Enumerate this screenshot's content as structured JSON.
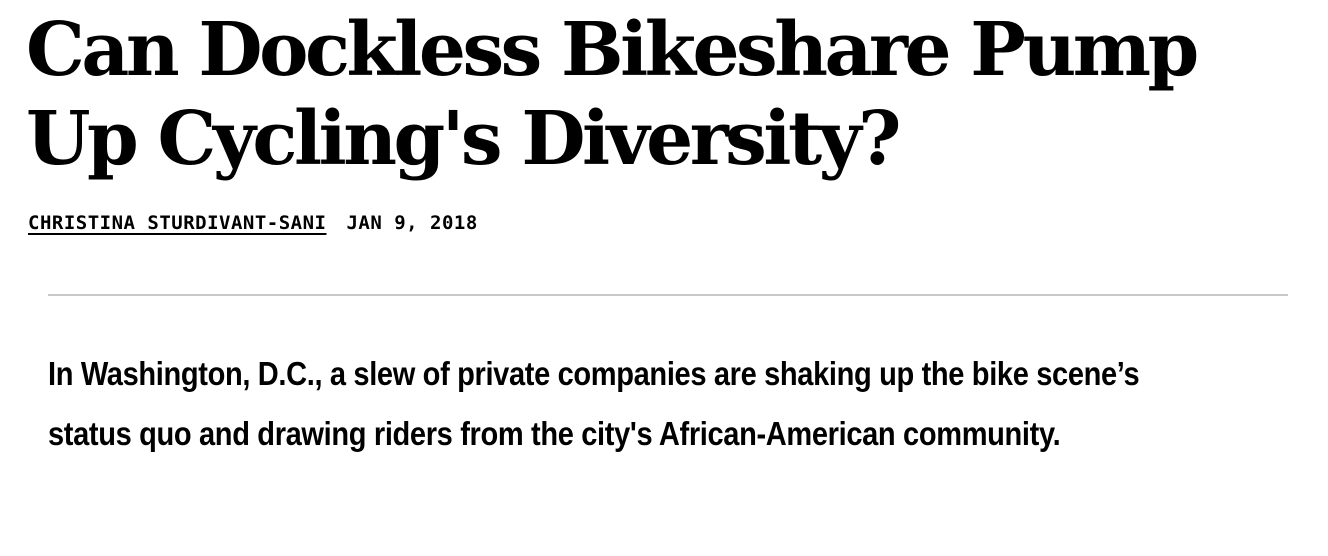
{
  "article": {
    "headline": "Can Dockless Bikeshare Pump Up Cycling's Diversity?",
    "author": "CHRISTINA STURDIVANT-SANI",
    "date": "JAN 9, 2018",
    "dek": "In Washington, D.C., a slew of private companies are shaking up the bike scene’s status quo and drawing riders from the city's African-American community."
  }
}
